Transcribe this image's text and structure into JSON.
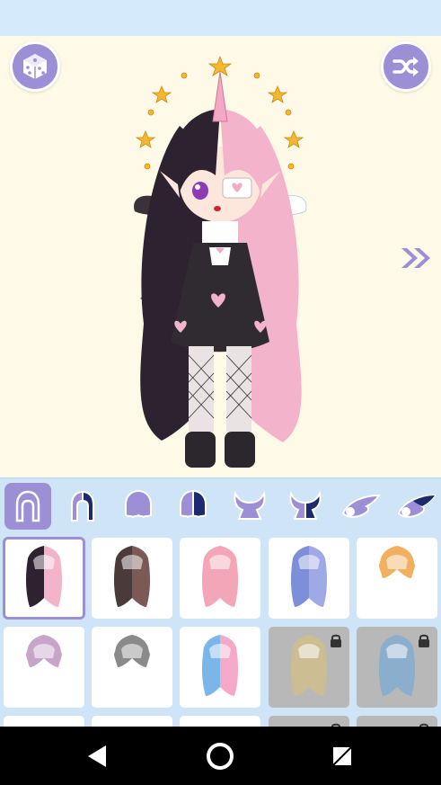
{
  "app": {
    "stage_background": "#fefae7",
    "accent": "#9d8fd6",
    "panel_background": "#cfe4f7"
  },
  "toolbar": {
    "random_icon": "dice-icon",
    "shuffle_icon": "shuffle-icon",
    "next_icon": "double-chevron-right-icon"
  },
  "tabs": [
    {
      "id": "hair-full",
      "icon": "hair-full-icon",
      "active": true
    },
    {
      "id": "hair-half",
      "icon": "hair-half-icon",
      "active": false
    },
    {
      "id": "hair-back",
      "icon": "hair-back-icon",
      "active": false
    },
    {
      "id": "hair-back-half",
      "icon": "hair-back-half-icon",
      "active": false
    },
    {
      "id": "horns",
      "icon": "horns-icon",
      "active": false
    },
    {
      "id": "horns-half",
      "icon": "horns-half-icon",
      "active": false
    },
    {
      "id": "wing-left",
      "icon": "wing-icon",
      "active": false
    },
    {
      "id": "wing-right",
      "icon": "wing-half-icon",
      "active": false
    }
  ],
  "items": [
    {
      "name": "hair-black-pink",
      "colors": [
        "#2e2230",
        "#f3b3cb"
      ],
      "selected": true,
      "locked": false
    },
    {
      "name": "hair-brown",
      "colors": [
        "#4a3a3a",
        "#7b5a55"
      ],
      "selected": false,
      "locked": false
    },
    {
      "name": "hair-pink",
      "colors": [
        "#f2a6b7",
        "#f2a6b7"
      ],
      "selected": false,
      "locked": false
    },
    {
      "name": "hair-blue",
      "colors": [
        "#7d8fd8",
        "#9fa9e6"
      ],
      "selected": false,
      "locked": false
    },
    {
      "name": "hair-orange-short",
      "colors": [
        "#f0b060",
        "#f0b060"
      ],
      "selected": false,
      "locked": false
    },
    {
      "name": "hair-lilac-short",
      "colors": [
        "#c7a5c9",
        "#c7a5c9"
      ],
      "selected": false,
      "locked": false
    },
    {
      "name": "hair-gray-short",
      "colors": [
        "#8a8a8a",
        "#8a8a8a"
      ],
      "selected": false,
      "locked": false
    },
    {
      "name": "hair-blue-pink",
      "colors": [
        "#7ab7e8",
        "#f5a9c8"
      ],
      "selected": false,
      "locked": false
    },
    {
      "name": "hair-blonde-locked",
      "colors": [
        "#d9c07a",
        "#d9c07a"
      ],
      "selected": false,
      "locked": true
    },
    {
      "name": "hair-teal-locked",
      "colors": [
        "#6aa7d9",
        "#6aa7d9"
      ],
      "selected": false,
      "locked": true
    },
    {
      "name": "row3-1",
      "colors": [
        "#ffffff",
        "#ffffff"
      ],
      "selected": false,
      "locked": false
    },
    {
      "name": "row3-2",
      "colors": [
        "#ffffff",
        "#ffffff"
      ],
      "selected": false,
      "locked": false
    },
    {
      "name": "row3-3",
      "colors": [
        "#ffffff",
        "#ffffff"
      ],
      "selected": false,
      "locked": false
    },
    {
      "name": "row3-4",
      "colors": [
        "#ffffff",
        "#ffffff"
      ],
      "selected": false,
      "locked": true
    },
    {
      "name": "row3-5",
      "colors": [
        "#ffffff",
        "#ffffff"
      ],
      "selected": false,
      "locked": true
    }
  ],
  "navigation": {
    "back_icon": "back-triangle-icon",
    "home_icon": "home-circle-icon",
    "recents_icon": "recents-square-icon"
  }
}
